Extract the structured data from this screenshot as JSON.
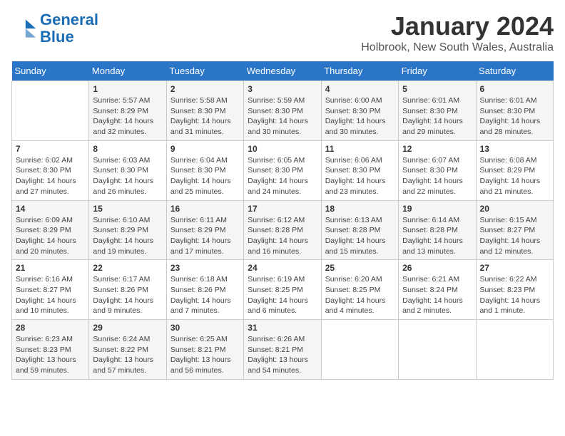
{
  "logo": {
    "line1": "General",
    "line2": "Blue"
  },
  "title": "January 2024",
  "subtitle": "Holbrook, New South Wales, Australia",
  "days_of_week": [
    "Sunday",
    "Monday",
    "Tuesday",
    "Wednesday",
    "Thursday",
    "Friday",
    "Saturday"
  ],
  "weeks": [
    [
      {
        "num": "",
        "detail": ""
      },
      {
        "num": "1",
        "detail": "Sunrise: 5:57 AM\nSunset: 8:29 PM\nDaylight: 14 hours\nand 32 minutes."
      },
      {
        "num": "2",
        "detail": "Sunrise: 5:58 AM\nSunset: 8:30 PM\nDaylight: 14 hours\nand 31 minutes."
      },
      {
        "num": "3",
        "detail": "Sunrise: 5:59 AM\nSunset: 8:30 PM\nDaylight: 14 hours\nand 30 minutes."
      },
      {
        "num": "4",
        "detail": "Sunrise: 6:00 AM\nSunset: 8:30 PM\nDaylight: 14 hours\nand 30 minutes."
      },
      {
        "num": "5",
        "detail": "Sunrise: 6:01 AM\nSunset: 8:30 PM\nDaylight: 14 hours\nand 29 minutes."
      },
      {
        "num": "6",
        "detail": "Sunrise: 6:01 AM\nSunset: 8:30 PM\nDaylight: 14 hours\nand 28 minutes."
      }
    ],
    [
      {
        "num": "7",
        "detail": "Sunrise: 6:02 AM\nSunset: 8:30 PM\nDaylight: 14 hours\nand 27 minutes."
      },
      {
        "num": "8",
        "detail": "Sunrise: 6:03 AM\nSunset: 8:30 PM\nDaylight: 14 hours\nand 26 minutes."
      },
      {
        "num": "9",
        "detail": "Sunrise: 6:04 AM\nSunset: 8:30 PM\nDaylight: 14 hours\nand 25 minutes."
      },
      {
        "num": "10",
        "detail": "Sunrise: 6:05 AM\nSunset: 8:30 PM\nDaylight: 14 hours\nand 24 minutes."
      },
      {
        "num": "11",
        "detail": "Sunrise: 6:06 AM\nSunset: 8:30 PM\nDaylight: 14 hours\nand 23 minutes."
      },
      {
        "num": "12",
        "detail": "Sunrise: 6:07 AM\nSunset: 8:30 PM\nDaylight: 14 hours\nand 22 minutes."
      },
      {
        "num": "13",
        "detail": "Sunrise: 6:08 AM\nSunset: 8:29 PM\nDaylight: 14 hours\nand 21 minutes."
      }
    ],
    [
      {
        "num": "14",
        "detail": "Sunrise: 6:09 AM\nSunset: 8:29 PM\nDaylight: 14 hours\nand 20 minutes."
      },
      {
        "num": "15",
        "detail": "Sunrise: 6:10 AM\nSunset: 8:29 PM\nDaylight: 14 hours\nand 19 minutes."
      },
      {
        "num": "16",
        "detail": "Sunrise: 6:11 AM\nSunset: 8:29 PM\nDaylight: 14 hours\nand 17 minutes."
      },
      {
        "num": "17",
        "detail": "Sunrise: 6:12 AM\nSunset: 8:28 PM\nDaylight: 14 hours\nand 16 minutes."
      },
      {
        "num": "18",
        "detail": "Sunrise: 6:13 AM\nSunset: 8:28 PM\nDaylight: 14 hours\nand 15 minutes."
      },
      {
        "num": "19",
        "detail": "Sunrise: 6:14 AM\nSunset: 8:28 PM\nDaylight: 14 hours\nand 13 minutes."
      },
      {
        "num": "20",
        "detail": "Sunrise: 6:15 AM\nSunset: 8:27 PM\nDaylight: 14 hours\nand 12 minutes."
      }
    ],
    [
      {
        "num": "21",
        "detail": "Sunrise: 6:16 AM\nSunset: 8:27 PM\nDaylight: 14 hours\nand 10 minutes."
      },
      {
        "num": "22",
        "detail": "Sunrise: 6:17 AM\nSunset: 8:26 PM\nDaylight: 14 hours\nand 9 minutes."
      },
      {
        "num": "23",
        "detail": "Sunrise: 6:18 AM\nSunset: 8:26 PM\nDaylight: 14 hours\nand 7 minutes."
      },
      {
        "num": "24",
        "detail": "Sunrise: 6:19 AM\nSunset: 8:25 PM\nDaylight: 14 hours\nand 6 minutes."
      },
      {
        "num": "25",
        "detail": "Sunrise: 6:20 AM\nSunset: 8:25 PM\nDaylight: 14 hours\nand 4 minutes."
      },
      {
        "num": "26",
        "detail": "Sunrise: 6:21 AM\nSunset: 8:24 PM\nDaylight: 14 hours\nand 2 minutes."
      },
      {
        "num": "27",
        "detail": "Sunrise: 6:22 AM\nSunset: 8:23 PM\nDaylight: 14 hours\nand 1 minute."
      }
    ],
    [
      {
        "num": "28",
        "detail": "Sunrise: 6:23 AM\nSunset: 8:23 PM\nDaylight: 13 hours\nand 59 minutes."
      },
      {
        "num": "29",
        "detail": "Sunrise: 6:24 AM\nSunset: 8:22 PM\nDaylight: 13 hours\nand 57 minutes."
      },
      {
        "num": "30",
        "detail": "Sunrise: 6:25 AM\nSunset: 8:21 PM\nDaylight: 13 hours\nand 56 minutes."
      },
      {
        "num": "31",
        "detail": "Sunrise: 6:26 AM\nSunset: 8:21 PM\nDaylight: 13 hours\nand 54 minutes."
      },
      {
        "num": "",
        "detail": ""
      },
      {
        "num": "",
        "detail": ""
      },
      {
        "num": "",
        "detail": ""
      }
    ]
  ]
}
